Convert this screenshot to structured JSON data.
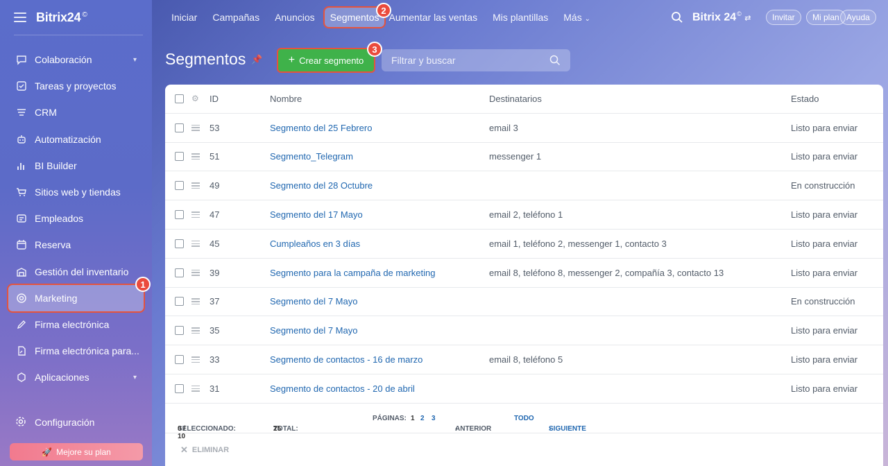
{
  "sidebar": {
    "brand": "Bitrix24",
    "brand_mark": "©",
    "items": [
      {
        "label": "Colaboración",
        "icon": "chat-icon",
        "chevron": true
      },
      {
        "label": "Tareas y proyectos",
        "icon": "task-icon"
      },
      {
        "label": "CRM",
        "icon": "crm-icon"
      },
      {
        "label": "Automatización",
        "icon": "robot-icon"
      },
      {
        "label": "BI Builder",
        "icon": "chart-icon"
      },
      {
        "label": "Sitios web y tiendas",
        "icon": "cart-icon"
      },
      {
        "label": "Empleados",
        "icon": "id-card-icon"
      },
      {
        "label": "Reserva",
        "icon": "calendar-icon"
      },
      {
        "label": "Gestión del inventario",
        "icon": "warehouse-icon"
      },
      {
        "label": "Marketing",
        "icon": "target-icon",
        "active": true
      },
      {
        "label": "Firma electrónica",
        "icon": "pen-icon"
      },
      {
        "label": "Firma electrónica para...",
        "icon": "doc-sign-icon"
      },
      {
        "label": "Aplicaciones",
        "icon": "cube-icon",
        "chevron": true
      }
    ],
    "config_label": "Configuración",
    "upgrade_label": "Mejore su plan"
  },
  "topbar": {
    "nav": [
      "Iniciar",
      "Campañas",
      "Anuncios",
      "Segmentos",
      "Aumentar las ventas",
      "Mis plantillas",
      "Más"
    ],
    "selected": "Segmentos",
    "brand": "Bitrix 24",
    "brand_mark": "©",
    "invite_label": "Invitar",
    "plan_label": "Mi plan",
    "help_label": "Ayuda"
  },
  "page": {
    "title": "Segmentos",
    "create_label": "Crear segmento",
    "filter_placeholder": "Filtrar y buscar"
  },
  "markers": [
    "1",
    "2",
    "3"
  ],
  "grid": {
    "columns": {
      "id": "ID",
      "name": "Nombre",
      "dest": "Destinatarios",
      "state": "Estado"
    },
    "rows": [
      {
        "id": "53",
        "name": "Segmento del 25 Febrero",
        "dest": "email 3",
        "state": "Listo para enviar"
      },
      {
        "id": "51",
        "name": "Segmento_Telegram",
        "dest": "messenger 1",
        "state": "Listo para enviar"
      },
      {
        "id": "49",
        "name": "Segmento del 28 Octubre",
        "dest": "",
        "state": "En construcción"
      },
      {
        "id": "47",
        "name": "Segmento del 17 Mayo",
        "dest": "email 2, teléfono 1",
        "state": "Listo para enviar"
      },
      {
        "id": "45",
        "name": "Cumpleaños en 3 días",
        "dest": "email 1, teléfono 2, messenger 1, contacto 3",
        "state": "Listo para enviar"
      },
      {
        "id": "39",
        "name": "Segmento para la campaña de marketing",
        "dest": "email 8, teléfono 8, messenger 2, compañía 3, contacto 13",
        "state": "Listo para enviar"
      },
      {
        "id": "37",
        "name": "Segmento del 7 Mayo",
        "dest": "",
        "state": "En construcción"
      },
      {
        "id": "35",
        "name": "Segmento del 7 Mayo",
        "dest": "",
        "state": "Listo para enviar"
      },
      {
        "id": "33",
        "name": "Segmento de contactos - 16 de marzo",
        "dest": "email 8, teléfono 5",
        "state": "Listo para enviar"
      },
      {
        "id": "31",
        "name": "Segmento de contactos - 20 de abril",
        "dest": "",
        "state": "Listo para enviar"
      }
    ],
    "footer": {
      "selected_label": "SELECCIONADO:",
      "selected_value": "0 / 10",
      "total_label": "TOTAL:",
      "total_value": "25",
      "pages_label": "PÁGINAS:",
      "pages": [
        "1",
        "2",
        "3"
      ],
      "prev_label": "ANTERIOR",
      "all_label": "TODO",
      "next_label": "SIGUIENTE"
    },
    "delete_label": "ELIMINAR"
  }
}
